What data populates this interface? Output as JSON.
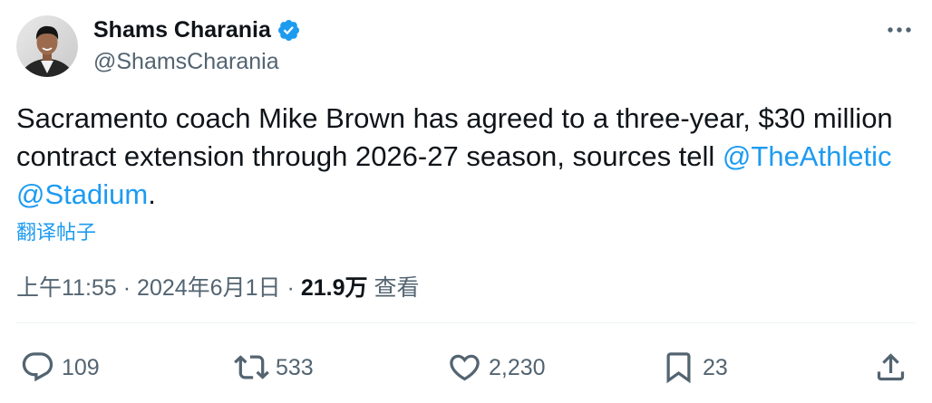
{
  "author": {
    "name": "Shams Charania",
    "handle": "@ShamsCharania",
    "verified": true
  },
  "tweet": {
    "segments": [
      {
        "type": "text",
        "text": "Sacramento coach Mike Brown has agreed to a three-year, $30 million contract extension through 2026-27 season, sources tell "
      },
      {
        "type": "mention",
        "text": "@TheAthletic"
      },
      {
        "type": "text",
        "text": " "
      },
      {
        "type": "mention",
        "text": "@Stadium"
      },
      {
        "type": "text",
        "text": "."
      }
    ],
    "translate_label": "翻译帖子"
  },
  "meta": {
    "time": "上午11:55",
    "separator": "·",
    "date": "2024年6月1日",
    "views_count": "21.9万",
    "views_label": "查看"
  },
  "actions": {
    "reply_count": "109",
    "retweet_count": "533",
    "like_count": "2,230",
    "bookmark_count": "23"
  },
  "icons": {
    "more": "more-icon",
    "verified": "verified-badge-icon",
    "reply": "reply-icon",
    "retweet": "retweet-icon",
    "like": "like-icon",
    "bookmark": "bookmark-icon",
    "share": "share-icon"
  },
  "colors": {
    "text": "#0f1419",
    "secondary": "#536471",
    "accent": "#1d9bf0",
    "divider": "#eff3f4",
    "background": "#ffffff"
  }
}
